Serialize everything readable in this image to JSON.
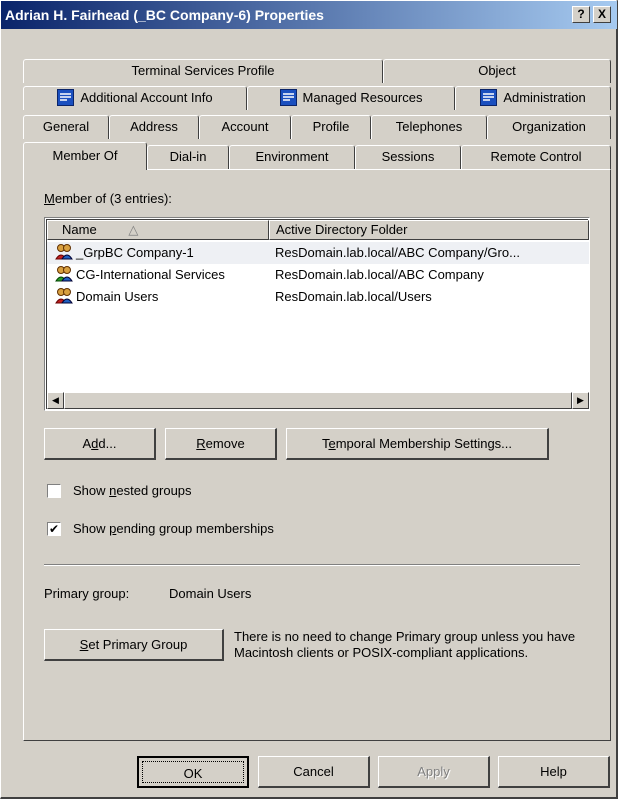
{
  "window": {
    "title": "Adrian H. Fairhead (_BC Company-6) Properties",
    "help_glyph": "?",
    "close_glyph": "X"
  },
  "tabs": {
    "row1": [
      "Terminal Services Profile",
      "Object"
    ],
    "row2": [
      "Additional Account Info",
      "Managed Resources",
      "Administration"
    ],
    "row3": [
      "General",
      "Address",
      "Account",
      "Profile",
      "Telephones",
      "Organization"
    ],
    "row4": [
      "Member Of",
      "Dial-in",
      "Environment",
      "Sessions",
      "Remote Control"
    ],
    "active": "Member Of"
  },
  "member_of": {
    "label_prefix": "M",
    "label_rest": "ember of (3 entries):",
    "columns": [
      "Name",
      "Active Directory Folder"
    ],
    "sort_glyph": "△",
    "rows": [
      {
        "name": "_GrpBC Company-1",
        "folder": "ResDomain.lab.local/ABC Company/Gro..."
      },
      {
        "name": "CG-International Services",
        "folder": "ResDomain.lab.local/ABC Company"
      },
      {
        "name": "Domain Users",
        "folder": "ResDomain.lab.local/Users"
      }
    ]
  },
  "buttons": {
    "add_a": "A",
    "add_u": "d",
    "add_b": "d...",
    "remove_u": "R",
    "remove_b": "emove",
    "temporal_a": "T",
    "temporal_u": "e",
    "temporal_b": "mporal Membership Settings...",
    "set_primary_u": "S",
    "set_primary_b": "et Primary Group",
    "ok": "OK",
    "cancel": "Cancel",
    "apply": "Apply",
    "help": "Help"
  },
  "options": {
    "show_nested_a": "Show ",
    "show_nested_u": "n",
    "show_nested_b": "ested groups",
    "show_nested_checked": false,
    "show_pending_a": "Show ",
    "show_pending_u": "p",
    "show_pending_b": "ending group memberships",
    "show_pending_checked": true,
    "check_glyph": "✔"
  },
  "primary": {
    "label": "Primary group:",
    "value": "Domain Users",
    "note": "There is no need to change Primary group unless you have Macintosh clients or POSIX-compliant applications."
  },
  "scroll": {
    "left_glyph": "◀",
    "right_glyph": "▶"
  }
}
